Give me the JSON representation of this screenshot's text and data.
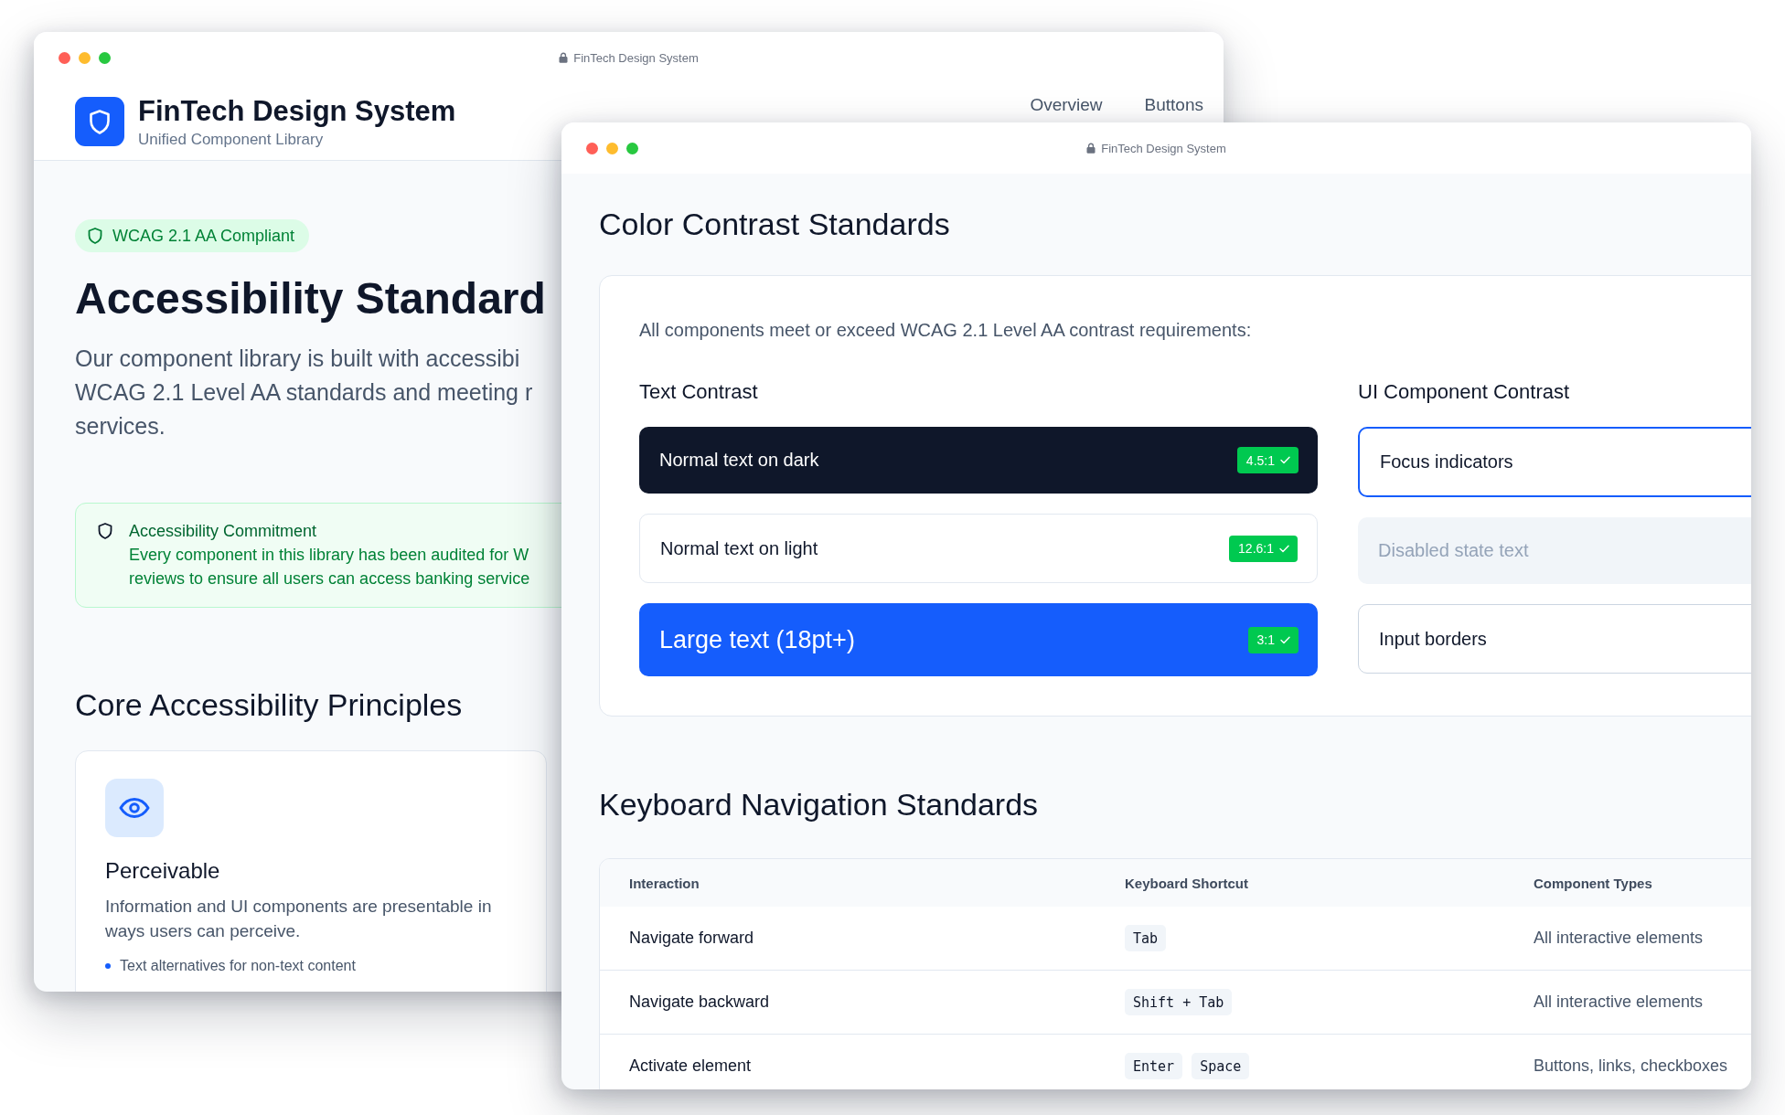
{
  "back_window": {
    "title": "FinTech Design System",
    "header": {
      "brand": "FinTech Design System",
      "tagline": "Unified Component Library",
      "nav": [
        {
          "label": "Overview"
        },
        {
          "label": "Buttons"
        }
      ]
    },
    "compliance_badge": "WCAG 2.1 AA Compliant",
    "heading": "Accessibility Standard",
    "intro_lines": [
      "Our component library is built with accessibi",
      "WCAG 2.1 Level AA standards and meeting r",
      "services."
    ],
    "commitment": {
      "title": "Accessibility Commitment",
      "lines": [
        "Every component in this library has been audited for W",
        "reviews to ensure all users can access banking service"
      ]
    },
    "principles": {
      "heading": "Core Accessibility Principles",
      "cards": [
        {
          "title": "Perceivable",
          "description": "Information and UI components are presentable in ways users can perceive.",
          "bullets": [
            "Text alternatives for non-text content"
          ]
        }
      ]
    }
  },
  "front_window": {
    "title": "FinTech Design System",
    "contrast": {
      "heading": "Color Contrast Standards",
      "intro": "All components meet or exceed WCAG 2.1 Level AA contrast requirements:",
      "groups": [
        {
          "heading": "Text Contrast",
          "samples": [
            {
              "kind": "dark",
              "label": "Normal text on dark",
              "ratio": "4.5:1"
            },
            {
              "kind": "light",
              "label": "Normal text on light",
              "ratio": "12.6:1"
            },
            {
              "kind": "large",
              "label": "Large text (18pt+)",
              "ratio": "3:1"
            }
          ]
        },
        {
          "heading": "UI Component Contrast",
          "samples": [
            {
              "kind": "focus",
              "label": "Focus indicators"
            },
            {
              "kind": "disabled",
              "label": "Disabled state text"
            },
            {
              "kind": "bordered",
              "label": "Input borders"
            }
          ]
        }
      ]
    },
    "keyboard": {
      "heading": "Keyboard Navigation Standards",
      "table": {
        "columns": [
          "Interaction",
          "Keyboard Shortcut",
          "Component Types"
        ],
        "rows": [
          {
            "interaction": "Navigate forward",
            "keys": [
              "Tab"
            ],
            "component_types": "All interactive elements"
          },
          {
            "interaction": "Navigate backward",
            "keys": [
              "Shift + Tab"
            ],
            "component_types": "All interactive elements"
          },
          {
            "interaction": "Activate element",
            "keys": [
              "Enter",
              "Space"
            ],
            "component_types": "Buttons, links, checkboxes"
          }
        ]
      }
    }
  }
}
